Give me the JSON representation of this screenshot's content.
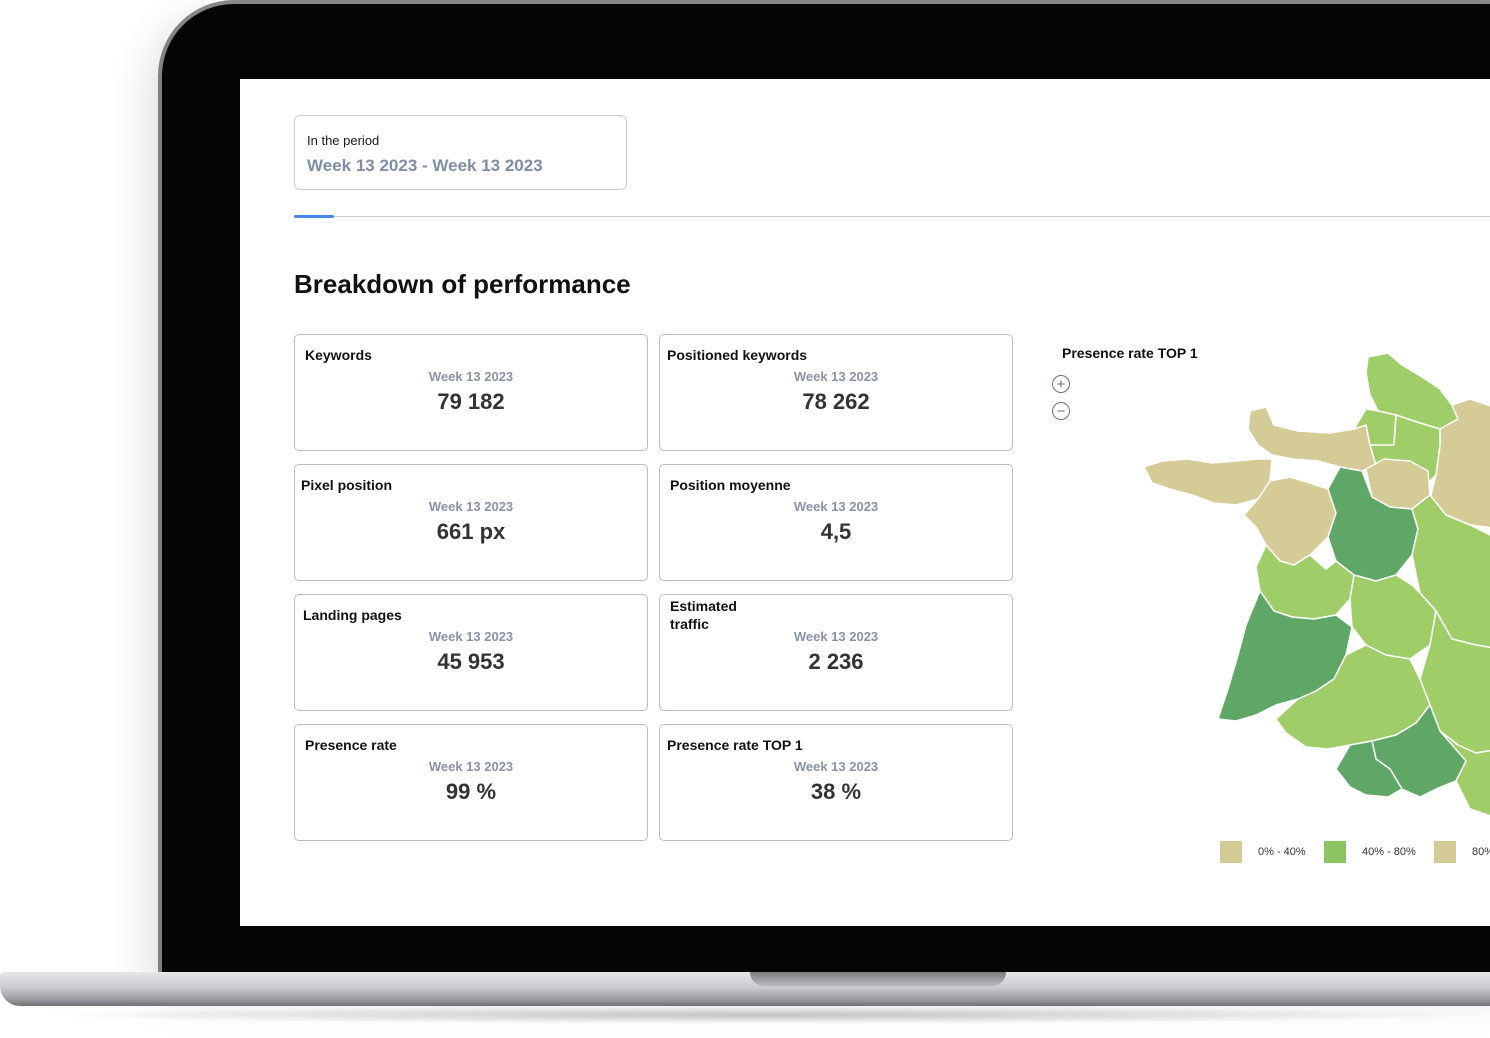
{
  "period": {
    "label": "In the period",
    "value": "Week 13 2023 - Week 13 2023"
  },
  "section_title": "Breakdown of performance",
  "cards": [
    {
      "title": "Keywords",
      "week": "Week 13 2023",
      "value": "79 182"
    },
    {
      "title": "Positioned keywords",
      "week": "Week 13 2023",
      "value": "78 262"
    },
    {
      "title": "Pixel position",
      "week": "Week 13 2023",
      "value": "661 px"
    },
    {
      "title": "Position moyenne",
      "week": "Week 13 2023",
      "value": "4,5"
    },
    {
      "title": "Landing pages",
      "week": "Week 13 2023",
      "value": "45 953"
    },
    {
      "title": "Estimated traffic",
      "week": "Week 13 2023",
      "value": "2 236"
    },
    {
      "title": "Presence rate",
      "week": "Week 13 2023",
      "value": "99 %"
    },
    {
      "title": "Presence rate TOP 1",
      "week": "Week 13 2023",
      "value": "38 %"
    }
  ],
  "map": {
    "title": "Presence rate TOP 1",
    "zoom_in": "+",
    "zoom_out": "−",
    "colors": {
      "low": "#d5cb96",
      "mid_light": "#9fcd67",
      "mid": "#8dc463",
      "high": "#5ea766"
    },
    "legend": [
      {
        "label": "0% - 40%",
        "color": "#d5cb96"
      },
      {
        "label": "40% - 80%",
        "color": "#8dc463"
      },
      {
        "label": "80%",
        "color": "#d5cb96"
      }
    ]
  }
}
